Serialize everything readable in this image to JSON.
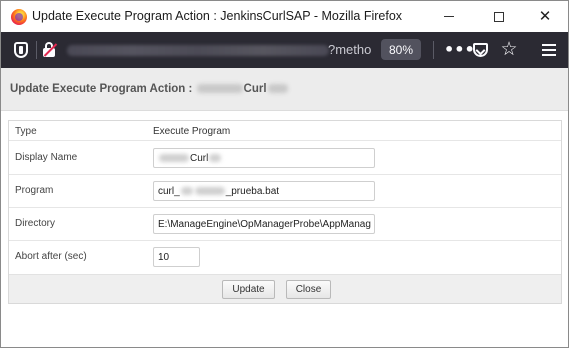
{
  "window": {
    "title": "Update Execute Program Action : JenkinsCurlSAP - Mozilla Firefox"
  },
  "toolbar": {
    "url_visible_fragment": "?metho",
    "zoom_level": "80%",
    "icons": [
      "shield-icon",
      "insecure-lock-icon",
      "more-actions-icon",
      "pocket-icon",
      "bookmark-star-icon",
      "hamburger-menu-icon"
    ]
  },
  "page": {
    "title_prefix": "Update Execute Program Action :",
    "title_visible_suffix": "Curl"
  },
  "form": {
    "type": {
      "label": "Type",
      "value": "Execute Program"
    },
    "display_name": {
      "label": "Display Name",
      "visible_value": "Curl"
    },
    "program": {
      "label": "Program",
      "value_start": "curl_",
      "value_end": "_prueba.bat"
    },
    "directory": {
      "label": "Directory",
      "value": "E:\\ManageEngine\\OpManagerProbe\\AppManag"
    },
    "abort_after": {
      "label": "Abort after (sec)",
      "value": "10"
    }
  },
  "buttons": {
    "update": "Update",
    "close": "Close"
  }
}
